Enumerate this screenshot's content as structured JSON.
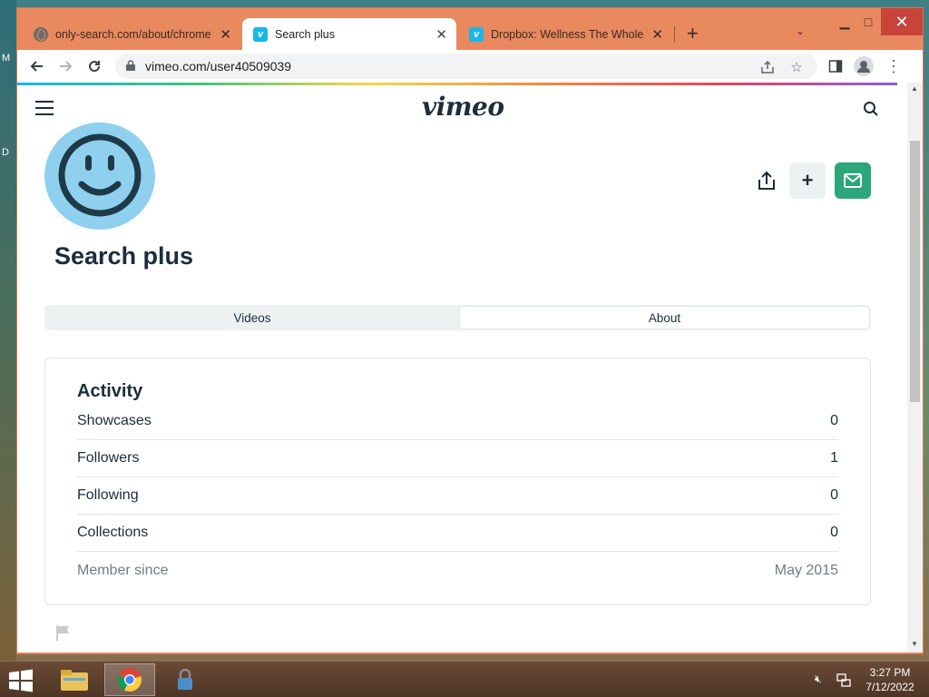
{
  "desktop": {
    "label_top": "M",
    "label_mid": "D"
  },
  "browser": {
    "tabs": [
      {
        "title": "only-search.com/about/chrome.h",
        "favicon": "globe-icon",
        "active": false
      },
      {
        "title": "Search plus",
        "favicon": "vimeo-icon",
        "active": true
      },
      {
        "title": "Dropbox: Wellness The Whole Ti",
        "favicon": "vimeo-icon",
        "active": false
      }
    ],
    "new_tab": "+",
    "url": "vimeo.com/user40509039"
  },
  "page": {
    "logo": "vimeo",
    "title": "Search plus",
    "tabs": {
      "videos": "Videos",
      "about": "About",
      "selected": "About"
    },
    "activity": {
      "heading": "Activity",
      "rows": [
        {
          "label": "Showcases",
          "value": "0"
        },
        {
          "label": "Followers",
          "value": "1"
        },
        {
          "label": "Following",
          "value": "0"
        },
        {
          "label": "Collections",
          "value": "0"
        },
        {
          "label": "Member since",
          "value": "May 2015"
        }
      ]
    },
    "colors": {
      "message_button": "#2ba779",
      "avatar": "#8fd0ee",
      "text": "#1a2e3b"
    }
  },
  "taskbar": {
    "time": "3:27 PM",
    "date": "7/12/2022"
  }
}
